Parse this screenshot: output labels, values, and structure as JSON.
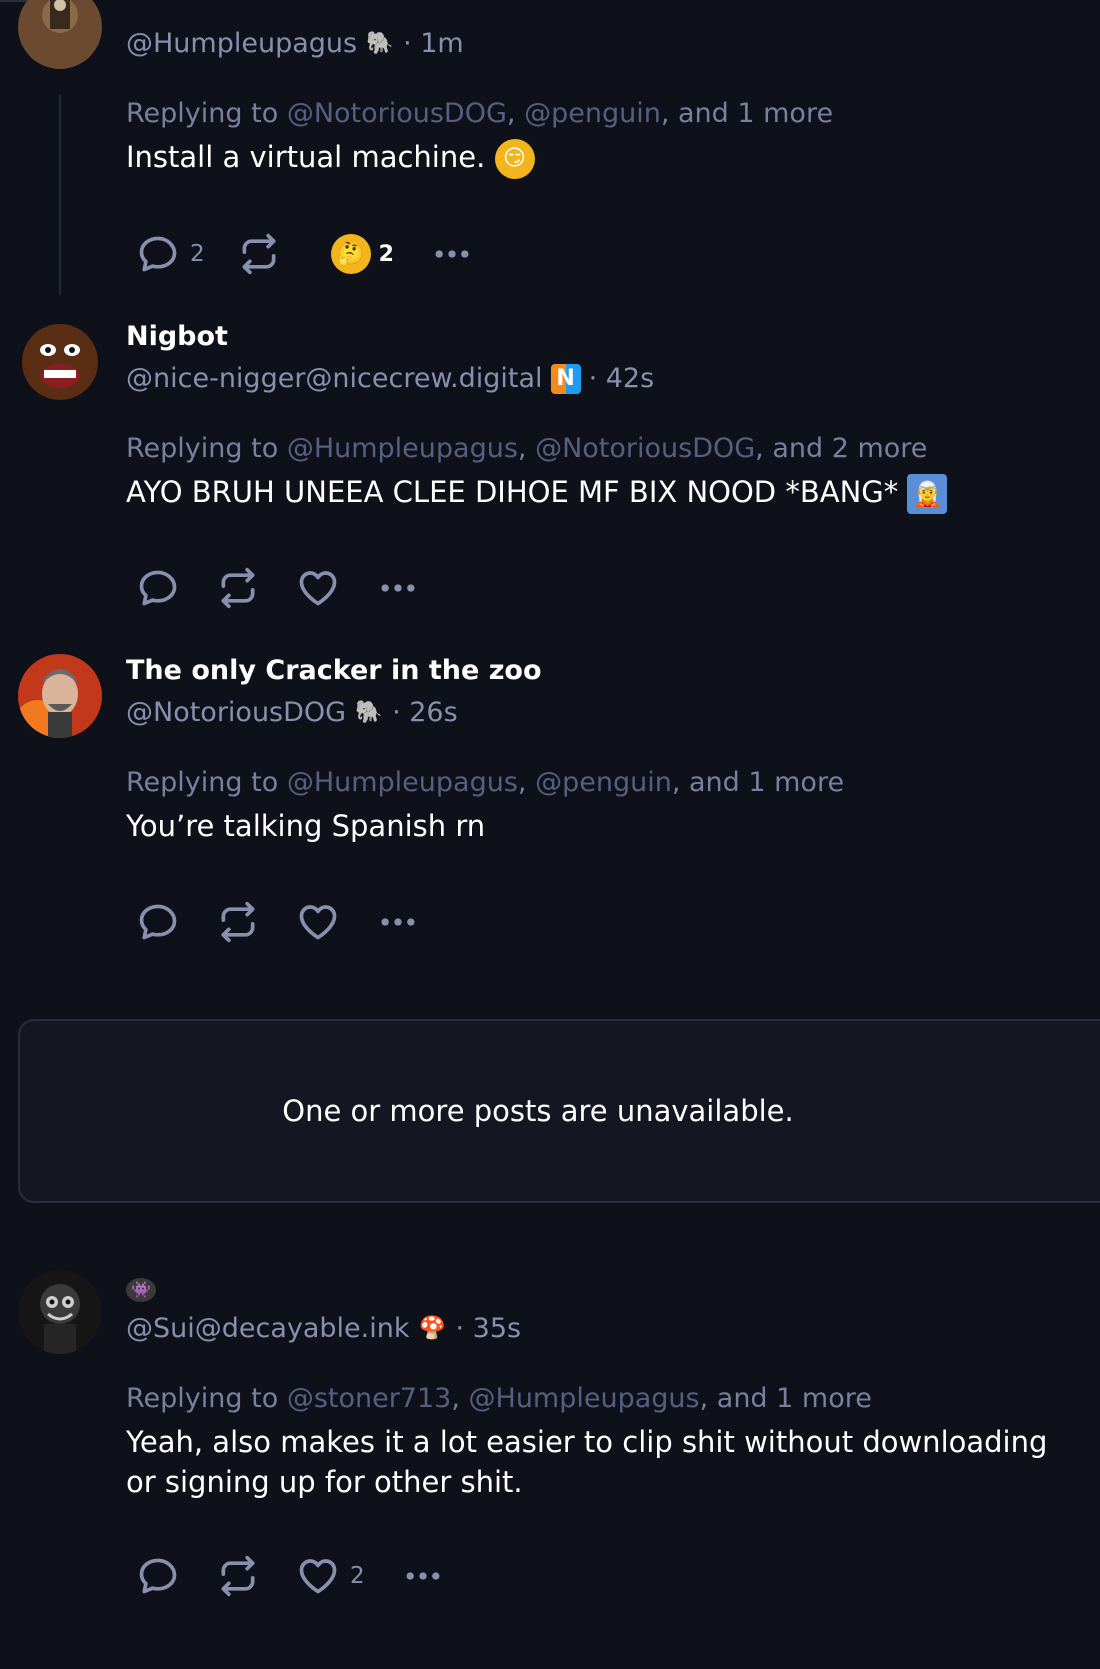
{
  "posts": [
    {
      "handle": "@Humpleupagus",
      "time": "· 1m",
      "replying": {
        "prefix": "Replying to ",
        "mentions": [
          "@NotoriousDOG",
          "@penguin"
        ],
        "suffix": ", and 1 more"
      },
      "text": "Install a virtual machine.",
      "badge": "elephant-icon",
      "reply_count": "2",
      "reaction_count": "2"
    },
    {
      "name": "Nigbot",
      "handle": "@nice-nigger@nicecrew.digital",
      "time": "· 42s",
      "replying": {
        "prefix": "Replying to ",
        "mentions": [
          "@Humpleupagus",
          "@NotoriousDOG"
        ],
        "suffix": ", and 2 more"
      },
      "text": "AYO BRUH UNEEA CLEE DIHOE MF BIX NOOD *BANG*"
    },
    {
      "name": "The only Cracker in the zoo",
      "handle": "@NotoriousDOG",
      "time": "· 26s",
      "replying": {
        "prefix": "Replying to ",
        "mentions": [
          "@Humpleupagus",
          "@penguin"
        ],
        "suffix": ", and 1 more"
      },
      "text": "You’re talking Spanish rn"
    },
    {
      "handle": "@Sui@decayable.ink",
      "time": "· 35s",
      "replying": {
        "prefix": "Replying to ",
        "mentions": [
          "@stoner713",
          "@Humpleupagus"
        ],
        "suffix": ", and 1 more"
      },
      "text": "Yeah, also makes it a lot easier to clip shit without downloading or signing up for other shit.",
      "like_count": "2"
    }
  ],
  "unavailable_text": "One or more posts are unavailable.",
  "separator": ", "
}
